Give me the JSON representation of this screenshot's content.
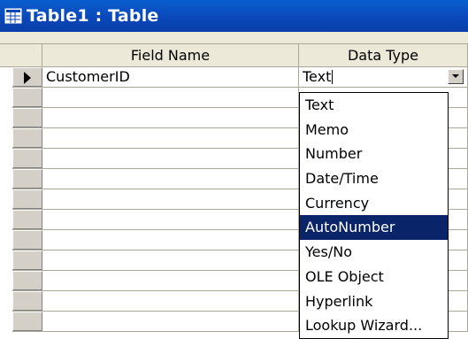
{
  "window": {
    "title": "Table1 : Table",
    "icon": "table-icon"
  },
  "columns": {
    "field_name": "Field Name",
    "data_type": "Data Type"
  },
  "rows": [
    {
      "field_name": "CustomerID",
      "data_type": "Text",
      "current": true
    }
  ],
  "dropdown": {
    "options": [
      "Text",
      "Memo",
      "Number",
      "Date/Time",
      "Currency",
      "AutoNumber",
      "Yes/No",
      "OLE Object",
      "Hyperlink",
      "Lookup Wizard..."
    ],
    "highlighted": "AutoNumber"
  },
  "colors": {
    "titlebar": "#0a46b8",
    "highlight": "#0a246a",
    "grid_line": "#aca899",
    "selector": "#d4d0c8"
  }
}
